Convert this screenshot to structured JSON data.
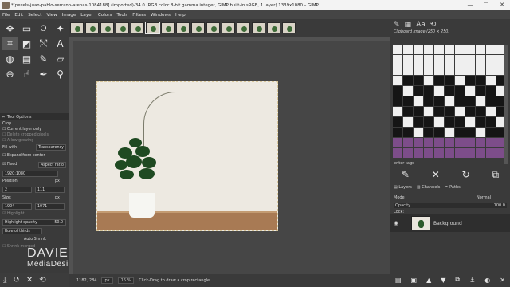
{
  "window": {
    "title": "*[pexels-juan-pablo-serrano-arenas-1084188] (imported)-34.0 (RGB color 8-bit gamma integer, GIMP built-in sRGB, 1 layer) 1339x1080 – GIMP",
    "minimize": "—",
    "maximize": "☐",
    "close": "✕"
  },
  "menu": [
    "File",
    "Edit",
    "Select",
    "View",
    "Image",
    "Layer",
    "Colors",
    "Tools",
    "Filters",
    "Windows",
    "Help"
  ],
  "tool_options": {
    "tab_label": "Tool Options",
    "tool_name": "Crop",
    "current_layer_only": "Current layer only",
    "delete_cropped": "Delete cropped pixels",
    "allow_growing": "Allow growing",
    "fill_with_label": "Fill with",
    "fill_with_value": "Transparency",
    "expand_from_center": "Expand from center",
    "fixed_label": "Fixed",
    "fixed_value": "Aspect ratio",
    "aspect_value": "1920:1080",
    "position_label": "Position:",
    "position_x": "2",
    "position_y": "111",
    "position_unit": "px",
    "size_label": "Size:",
    "size_w": "1904",
    "size_h": "1071",
    "size_unit": "px",
    "highlight_label": "Highlight",
    "highlight_opacity_label": "Highlight opacity",
    "highlight_opacity_value": "50.0",
    "guides_value": "Rule of thirds",
    "auto_shrink": "Auto Shrink",
    "shrink_merged": "Shrink merged"
  },
  "watermark": {
    "line1": "DAVIES",
    "line2": "MediaDesign"
  },
  "status": {
    "coords": "1182, 284",
    "unit": "px",
    "zoom": "16 %",
    "message": "Click-Drag to draw a crop rectangle"
  },
  "dock": {
    "clipboard_label": "Clipboard Image (250 × 250)",
    "filter_label": "enter tags",
    "layers_tab": "Layers",
    "channels_tab": "Channels",
    "paths_tab": "Paths",
    "mode_label": "Mode",
    "mode_value": "Normal",
    "opacity_label": "Opacity",
    "opacity_value": "100.0",
    "lock_label": "Lock:",
    "layer_name": "Background"
  },
  "colors": {
    "foreground": "#1ec81e",
    "background": "#ffffff",
    "ui_dark": "#3c3c3c"
  }
}
